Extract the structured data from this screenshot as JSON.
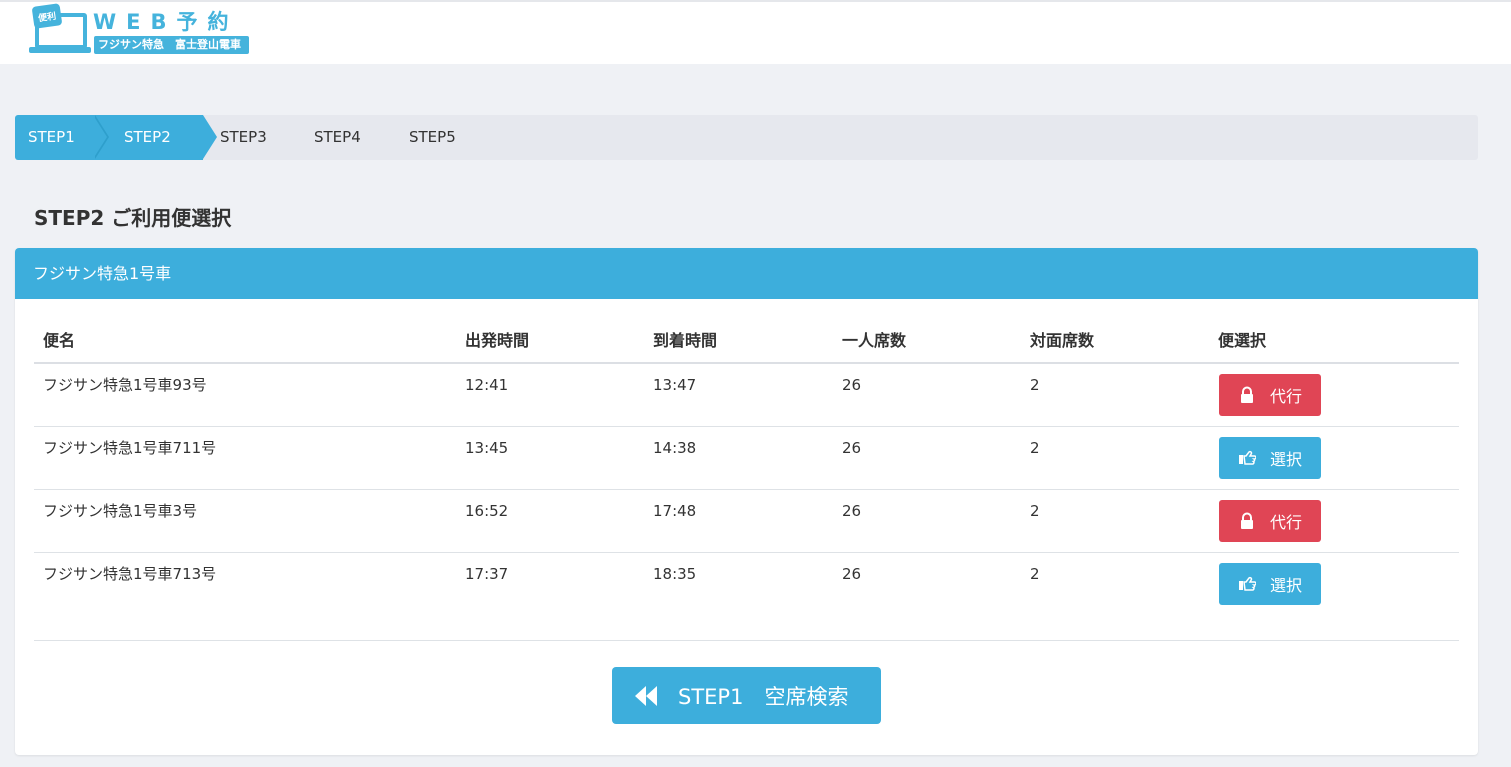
{
  "header": {
    "logo_badge": "便利",
    "logo_title": "WEB予約",
    "logo_sub": "フジサン特急　富士登山電車"
  },
  "steps": [
    {
      "label": "STEP1",
      "active": true
    },
    {
      "label": "STEP2",
      "active": true
    },
    {
      "label": "STEP3",
      "active": false
    },
    {
      "label": "STEP4",
      "active": false
    },
    {
      "label": "STEP5",
      "active": false
    }
  ],
  "page_title": "STEP2 ご利用便選択",
  "panel": {
    "title": "フジサン特急1号車",
    "columns": [
      "便名",
      "出発時間",
      "到着時間",
      "一人席数",
      "対面席数",
      "便選択"
    ],
    "rows": [
      {
        "name": "フジサン特急1号車93号",
        "depart": "12:41",
        "arrive": "13:47",
        "single": "26",
        "facing": "2",
        "action": "代行",
        "action_type": "locked"
      },
      {
        "name": "フジサン特急1号車711号",
        "depart": "13:45",
        "arrive": "14:38",
        "single": "26",
        "facing": "2",
        "action": "選択",
        "action_type": "select"
      },
      {
        "name": "フジサン特急1号車3号",
        "depart": "16:52",
        "arrive": "17:48",
        "single": "26",
        "facing": "2",
        "action": "代行",
        "action_type": "locked"
      },
      {
        "name": "フジサン特急1号車713号",
        "depart": "17:37",
        "arrive": "18:35",
        "single": "26",
        "facing": "2",
        "action": "選択",
        "action_type": "select"
      }
    ]
  },
  "back_button": {
    "label": "STEP1　空席検索",
    "icon": "backward-icon"
  },
  "colors": {
    "accent": "#3daedc",
    "danger": "#e04555",
    "background": "#eff1f5"
  }
}
